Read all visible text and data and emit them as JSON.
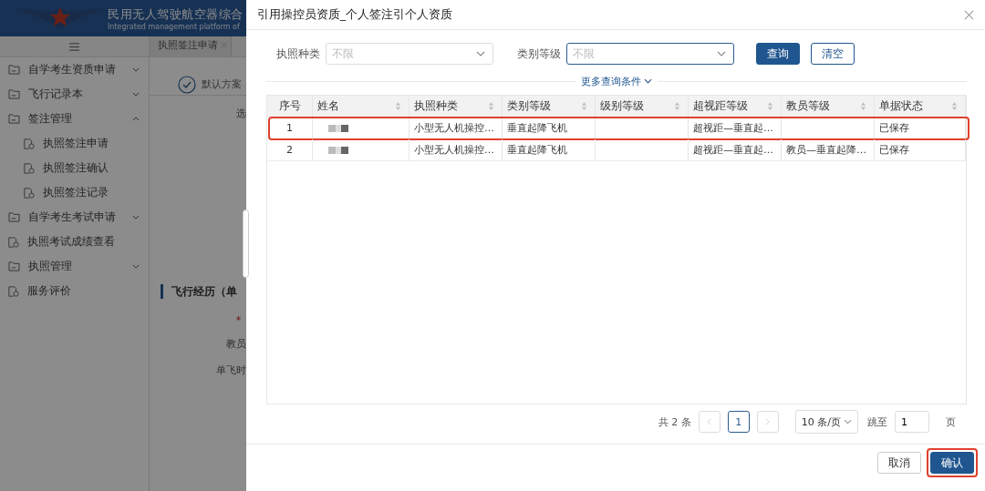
{
  "background_app": {
    "header": {
      "title": "民用无人驾驶航空器综合",
      "subtitle": "Integrated management platform of"
    },
    "sidebar": {
      "items": [
        {
          "label": "自学考生资质申请",
          "kind": "folder",
          "expanded": false
        },
        {
          "label": "飞行记录本",
          "kind": "folder",
          "expanded": false
        },
        {
          "label": "签注管理",
          "kind": "folder",
          "expanded": true,
          "children": [
            {
              "label": "执照签注申请",
              "kind": "page"
            },
            {
              "label": "执照签注确认",
              "kind": "page"
            },
            {
              "label": "执照签注记录",
              "kind": "page"
            }
          ]
        },
        {
          "label": "自学考生考试申请",
          "kind": "folder",
          "expanded": false
        },
        {
          "label": "执照考试成绩查看",
          "kind": "page"
        },
        {
          "label": "执照管理",
          "kind": "folder",
          "expanded": false
        },
        {
          "label": "服务评价",
          "kind": "page"
        }
      ]
    },
    "tabs": [
      {
        "label": "执照签注申请",
        "closable": true
      }
    ],
    "content": {
      "scheme": "默认方案",
      "select_label": "选",
      "section_title": "飞行经历（单",
      "fields": [
        {
          "required": true
        },
        {
          "label": "教员",
          "required": false
        },
        {
          "label": "单飞时",
          "required": false
        }
      ]
    }
  },
  "dialog": {
    "title": "引用操控员资质_个人签注引个人资质",
    "filters": [
      {
        "label": "执照种类",
        "placeholder": "不限",
        "focused": false
      },
      {
        "label": "类别等级",
        "placeholder": "不限",
        "focused": true
      }
    ],
    "search_button": "查询",
    "clear_button": "清空",
    "more_conditions": "更多查询条件",
    "columns": [
      {
        "label": "序号",
        "sortable": false
      },
      {
        "label": "姓名",
        "sortable": true
      },
      {
        "label": "执照种类",
        "sortable": true
      },
      {
        "label": "类别等级",
        "sortable": true
      },
      {
        "label": "级别等级",
        "sortable": true
      },
      {
        "label": "超视距等级",
        "sortable": true
      },
      {
        "label": "教员等级",
        "sortable": true
      },
      {
        "label": "单据状态",
        "sortable": true
      }
    ],
    "rows": [
      {
        "index": "1",
        "license_type": "小型无人机操控…",
        "category": "垂直起降飞机",
        "level": "",
        "bvlos": "超视距—垂直起…",
        "instructor": "",
        "status": "已保存",
        "highlighted": true
      },
      {
        "index": "2",
        "license_type": "小型无人机操控…",
        "category": "垂直起降飞机",
        "level": "",
        "bvlos": "超视距—垂直起…",
        "instructor": "教员—垂直起降…",
        "status": "已保存",
        "highlighted": false
      }
    ],
    "pagination": {
      "total": "共 2 条",
      "pages": [
        {
          "label": "1",
          "selected": true
        }
      ],
      "page_size": "10 条/页",
      "jump_label": "跳至",
      "jump_value": "1",
      "page_unit": "页"
    },
    "cancel_button": "取消",
    "confirm_button": {
      "label": "确认",
      "highlighted": true
    }
  }
}
